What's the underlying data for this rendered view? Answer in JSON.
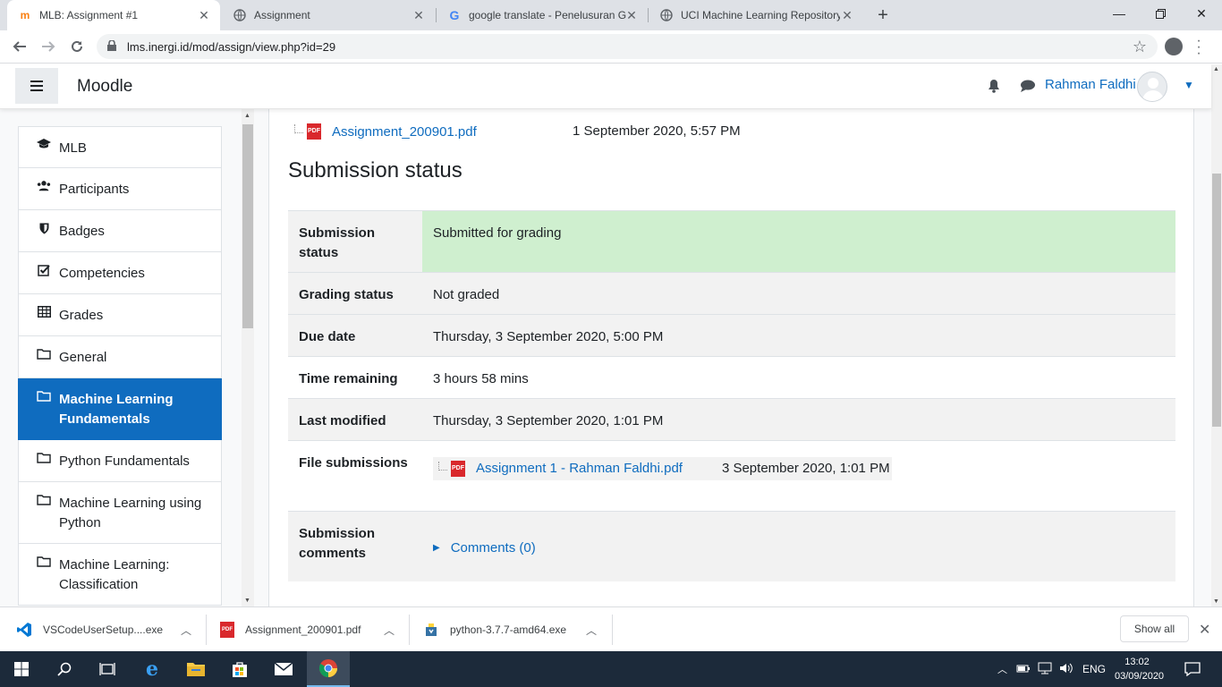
{
  "browser": {
    "tabs": [
      {
        "title": "MLB: Assignment #1",
        "active": true
      },
      {
        "title": "Assignment",
        "active": false
      },
      {
        "title": "google translate - Penelusuran G",
        "active": false
      },
      {
        "title": "UCI Machine Learning Repository",
        "active": false
      }
    ],
    "url": "lms.inergi.id/mod/assign/view.php?id=29"
  },
  "header": {
    "brand": "Moodle",
    "user_name": "Rahman Faldhi"
  },
  "sidebar": {
    "items": [
      {
        "label": "MLB",
        "icon": "graduation-cap-icon"
      },
      {
        "label": "Participants",
        "icon": "users-icon"
      },
      {
        "label": "Badges",
        "icon": "shield-icon"
      },
      {
        "label": "Competencies",
        "icon": "checkbox-icon"
      },
      {
        "label": "Grades",
        "icon": "table-icon"
      },
      {
        "label": "General",
        "icon": "folder-icon"
      },
      {
        "label": "Machine Learning Fundamentals",
        "icon": "folder-icon",
        "active": true
      },
      {
        "label": "Python Fundamentals",
        "icon": "folder-icon"
      },
      {
        "label": "Machine Learning using Python",
        "icon": "folder-icon"
      },
      {
        "label": "Machine Learning: Classification",
        "icon": "folder-icon"
      }
    ]
  },
  "main": {
    "intro_file": {
      "name": "Assignment_200901.pdf",
      "date": "1 September 2020, 5:57 PM"
    },
    "section_title": "Submission status",
    "rows": {
      "submission_status": {
        "label": "Submission status",
        "value": "Submitted for grading"
      },
      "grading_status": {
        "label": "Grading status",
        "value": "Not graded"
      },
      "due_date": {
        "label": "Due date",
        "value": "Thursday, 3 September 2020, 5:00 PM"
      },
      "time_remaining": {
        "label": "Time remaining",
        "value": "3 hours 58 mins"
      },
      "last_modified": {
        "label": "Last modified",
        "value": "Thursday, 3 September 2020, 1:01 PM"
      },
      "file_submissions": {
        "label": "File submissions",
        "file_name": "Assignment 1 - Rahman Faldhi.pdf",
        "file_date": "3 September 2020, 1:01 PM"
      },
      "submission_comments": {
        "label": "Submission comments",
        "link": "Comments (0)"
      }
    }
  },
  "downloads": {
    "items": [
      "VSCodeUserSetup....exe",
      "Assignment_200901.pdf",
      "python-3.7.7-amd64.exe"
    ],
    "show_all": "Show all"
  },
  "taskbar": {
    "language": "ENG",
    "time": "13:02",
    "date": "03/09/2020"
  },
  "colors": {
    "accent": "#0f6cbf",
    "success_bg": "#cfefcf",
    "pdf_red": "#d9282c"
  }
}
